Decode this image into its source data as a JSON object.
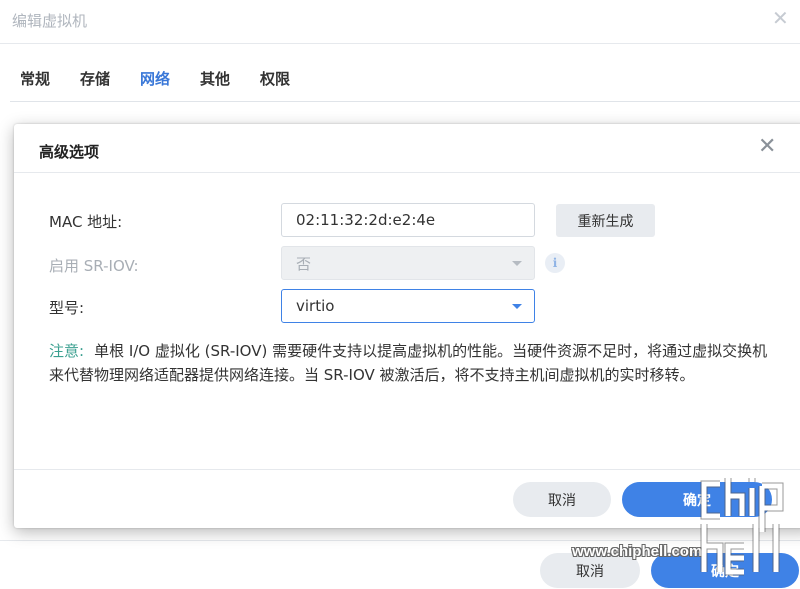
{
  "background_window": {
    "title": "编辑虚拟机",
    "tabs": [
      {
        "label": "常规"
      },
      {
        "label": "存储"
      },
      {
        "label": "网络",
        "active": true
      },
      {
        "label": "其他"
      },
      {
        "label": "权限"
      }
    ],
    "cancel_label": "取消",
    "ok_label": "确定"
  },
  "dialog": {
    "title": "高级选项",
    "close_icon": "close-icon",
    "mac": {
      "label": "MAC 地址:",
      "value": "02:11:32:2d:e2:4e",
      "regen_label": "重新生成"
    },
    "sriov": {
      "label": "启用 SR-IOV:",
      "value": "否",
      "info_icon": "info-icon",
      "info_glyph": "i"
    },
    "model": {
      "label": "型号:",
      "value": "virtio"
    },
    "note": {
      "label": "注意:",
      "text": "单根 I/O 虚拟化 (SR-IOV) 需要硬件支持以提高虚拟机的性能。当硬件资源不足时，将通过虚拟交换机来代替物理网络适配器提供网络连接。当 SR-IOV 被激活后，将不支持主机间虚拟机的实时移转。"
    },
    "cancel_label": "取消",
    "ok_label": "确定"
  },
  "watermark": {
    "url": "www.chiphell.com",
    "logo_text": "chip hell"
  },
  "colors": {
    "accent": "#3f82e6",
    "active_tab": "#3a78d8",
    "note_label": "#3a9f8f"
  }
}
